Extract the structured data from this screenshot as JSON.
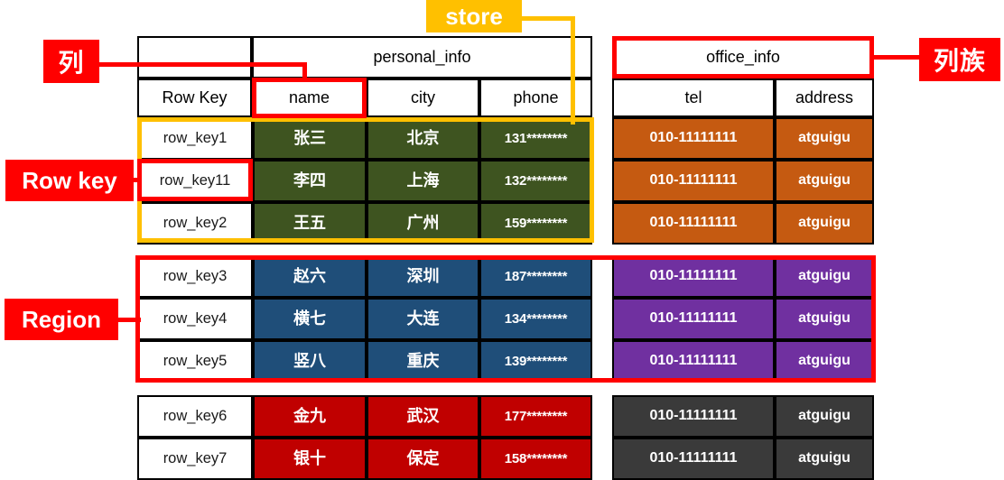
{
  "diagram": {
    "title_hidden": "HBase table structure diagram",
    "annotations": {
      "column": "列",
      "column_family": "列族",
      "row_key": "Row key",
      "region": "Region",
      "store": "store"
    },
    "left_table": {
      "family_header": "personal_info",
      "columns": [
        "Row Key",
        "name",
        "city",
        "phone"
      ],
      "rows": [
        {
          "row_key": "row_key1",
          "name": "张三",
          "city": "北京",
          "phone": "131********",
          "group": "green"
        },
        {
          "row_key": "row_key11",
          "name": "李四",
          "city": "上海",
          "phone": "132********",
          "group": "green"
        },
        {
          "row_key": "row_key2",
          "name": "王五",
          "city": "广州",
          "phone": "159********",
          "group": "green"
        },
        {
          "row_key": "row_key3",
          "name": "赵六",
          "city": "深圳",
          "phone": "187********",
          "group": "blue"
        },
        {
          "row_key": "row_key4",
          "name": "横七",
          "city": "大连",
          "phone": "134********",
          "group": "blue"
        },
        {
          "row_key": "row_key5",
          "name": "竖八",
          "city": "重庆",
          "phone": "139********",
          "group": "blue"
        },
        {
          "row_key": "row_key6",
          "name": "金九",
          "city": "武汉",
          "phone": "177********",
          "group": "red"
        },
        {
          "row_key": "row_key7",
          "name": "银十",
          "city": "保定",
          "phone": "158********",
          "group": "red"
        }
      ]
    },
    "right_table": {
      "family_header": "office_info",
      "columns": [
        "tel",
        "address"
      ],
      "rows": [
        {
          "tel": "010-11111111",
          "address": "atguigu",
          "group": "orange"
        },
        {
          "tel": "010-11111111",
          "address": "atguigu",
          "group": "orange"
        },
        {
          "tel": "010-11111111",
          "address": "atguigu",
          "group": "orange"
        },
        {
          "tel": "010-11111111",
          "address": "atguigu",
          "group": "purple"
        },
        {
          "tel": "010-11111111",
          "address": "atguigu",
          "group": "purple"
        },
        {
          "tel": "010-11111111",
          "address": "atguigu",
          "group": "purple"
        },
        {
          "tel": "010-11111111",
          "address": "atguigu",
          "group": "gray"
        },
        {
          "tel": "010-11111111",
          "address": "atguigu",
          "group": "gray"
        }
      ]
    },
    "colors": {
      "annotation_red": "#FF0000",
      "store_yellow": "#FFC000",
      "group_green": "#3E5420",
      "group_blue": "#1F4E79",
      "group_red": "#C00000",
      "group_orange": "#C55A11",
      "group_purple": "#7030A0",
      "group_gray": "#3A3A3A",
      "border_black": "#000000"
    }
  }
}
